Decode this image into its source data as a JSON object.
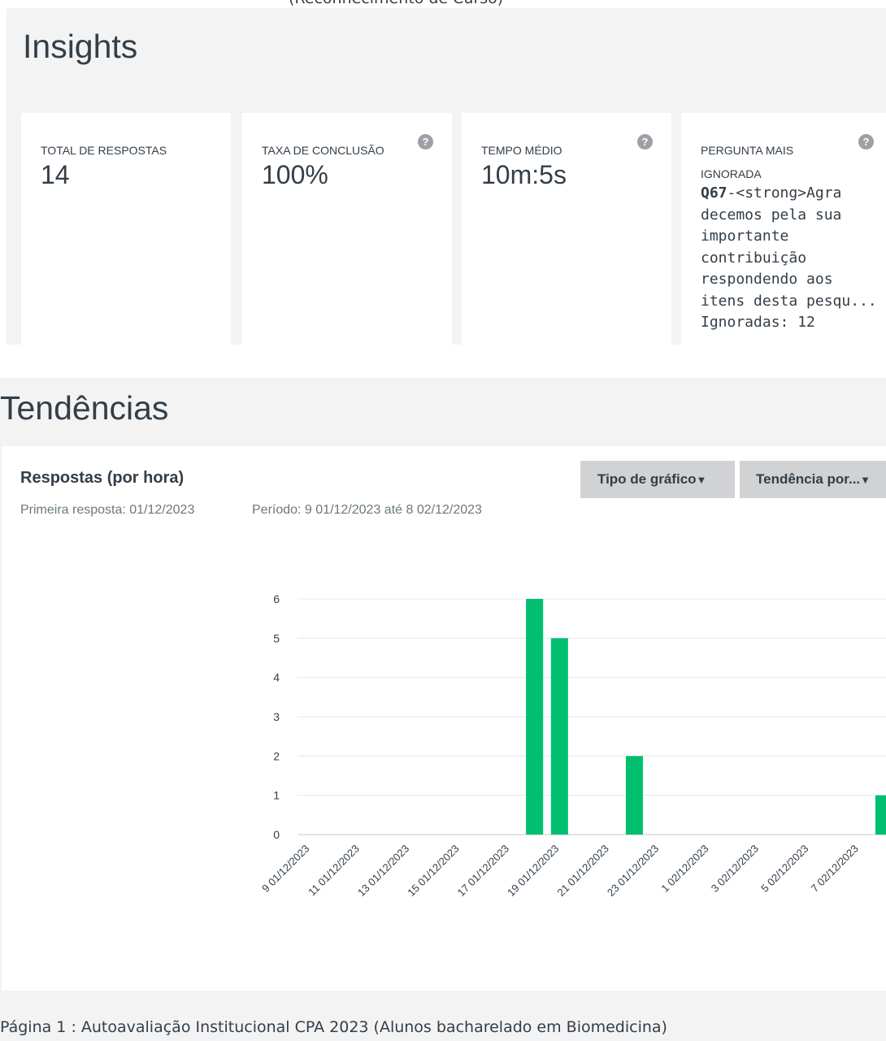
{
  "header": {
    "cut_title": "(Reconhecimento de Curso)"
  },
  "insights": {
    "title": "Insights",
    "cards": [
      {
        "label": "TOTAL DE RESPOSTAS",
        "value": "14"
      },
      {
        "label": "TAXA DE CONCLUSÃO",
        "value": "100%"
      },
      {
        "label": "TEMPO MÉDIO",
        "value": "10m:5s"
      },
      {
        "label_line1": "PERGUNTA MAIS",
        "label_line2": "IGNORADA",
        "question_id": "Q67",
        "question_lines": [
          "-<strong>Agra",
          "decemos pela sua",
          "importante",
          "contribuição",
          "respondendo aos",
          "itens desta pesqu..."
        ],
        "skipped": "Ignoradas: 12"
      }
    ],
    "help_glyph": "?"
  },
  "trends": {
    "title": "Tendências",
    "chart_title": "Respostas (por hora)",
    "first_response": "Primeira resposta: 01/12/2023",
    "period": "Período: 9 01/12/2023 até 8 02/12/2023",
    "chart_type_button": "Tipo de gráfico",
    "trend_by_button": "Tendência por...",
    "dropdown_glyph": "▼"
  },
  "footer": {
    "page_label": "Página 1 : Autoavaliação Institucional CPA 2023 (Alunos bacharelado em Biomedicina)"
  },
  "colors": {
    "bar": "#00bf6f",
    "panel_bg": "#f3f3f3",
    "button_bg": "#d0d2d3"
  },
  "chart_data": {
    "type": "bar",
    "title": "Respostas (por hora)",
    "xlabel": "",
    "ylabel": "",
    "ylim": [
      0,
      6
    ],
    "yticks": [
      0,
      1,
      2,
      3,
      4,
      5,
      6
    ],
    "grid": true,
    "tick_labels": [
      "9 01/12/2023",
      "11 01/12/2023",
      "13 01/12/2023",
      "15 01/12/2023",
      "17 01/12/2023",
      "19 01/12/2023",
      "21 01/12/2023",
      "23 01/12/2023",
      "1 02/12/2023",
      "3 02/12/2023",
      "5 02/12/2023",
      "7 02/12/2023"
    ],
    "categories": [
      "9 01/12/2023",
      "10 01/12/2023",
      "11 01/12/2023",
      "12 01/12/2023",
      "13 01/12/2023",
      "14 01/12/2023",
      "15 01/12/2023",
      "16 01/12/2023",
      "17 01/12/2023",
      "18 01/12/2023",
      "19 01/12/2023",
      "20 01/12/2023",
      "21 01/12/2023",
      "22 01/12/2023",
      "23 01/12/2023",
      "0 02/12/2023",
      "1 02/12/2023",
      "2 02/12/2023",
      "3 02/12/2023",
      "4 02/12/2023",
      "5 02/12/2023",
      "6 02/12/2023",
      "7 02/12/2023",
      "8 02/12/2023"
    ],
    "values": [
      0,
      0,
      0,
      0,
      0,
      0,
      0,
      0,
      0,
      6,
      5,
      0,
      0,
      2,
      0,
      0,
      0,
      0,
      0,
      0,
      0,
      0,
      0,
      1
    ]
  }
}
